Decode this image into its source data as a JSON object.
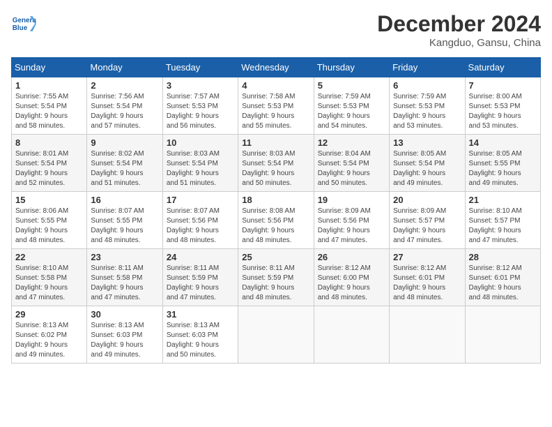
{
  "header": {
    "logo_line1": "General",
    "logo_line2": "Blue",
    "month": "December 2024",
    "location": "Kangduo, Gansu, China"
  },
  "weekdays": [
    "Sunday",
    "Monday",
    "Tuesday",
    "Wednesday",
    "Thursday",
    "Friday",
    "Saturday"
  ],
  "weeks": [
    [
      {
        "day": "1",
        "info": "Sunrise: 7:55 AM\nSunset: 5:54 PM\nDaylight: 9 hours\nand 58 minutes."
      },
      {
        "day": "2",
        "info": "Sunrise: 7:56 AM\nSunset: 5:54 PM\nDaylight: 9 hours\nand 57 minutes."
      },
      {
        "day": "3",
        "info": "Sunrise: 7:57 AM\nSunset: 5:53 PM\nDaylight: 9 hours\nand 56 minutes."
      },
      {
        "day": "4",
        "info": "Sunrise: 7:58 AM\nSunset: 5:53 PM\nDaylight: 9 hours\nand 55 minutes."
      },
      {
        "day": "5",
        "info": "Sunrise: 7:59 AM\nSunset: 5:53 PM\nDaylight: 9 hours\nand 54 minutes."
      },
      {
        "day": "6",
        "info": "Sunrise: 7:59 AM\nSunset: 5:53 PM\nDaylight: 9 hours\nand 53 minutes."
      },
      {
        "day": "7",
        "info": "Sunrise: 8:00 AM\nSunset: 5:53 PM\nDaylight: 9 hours\nand 53 minutes."
      }
    ],
    [
      {
        "day": "8",
        "info": "Sunrise: 8:01 AM\nSunset: 5:54 PM\nDaylight: 9 hours\nand 52 minutes."
      },
      {
        "day": "9",
        "info": "Sunrise: 8:02 AM\nSunset: 5:54 PM\nDaylight: 9 hours\nand 51 minutes."
      },
      {
        "day": "10",
        "info": "Sunrise: 8:03 AM\nSunset: 5:54 PM\nDaylight: 9 hours\nand 51 minutes."
      },
      {
        "day": "11",
        "info": "Sunrise: 8:03 AM\nSunset: 5:54 PM\nDaylight: 9 hours\nand 50 minutes."
      },
      {
        "day": "12",
        "info": "Sunrise: 8:04 AM\nSunset: 5:54 PM\nDaylight: 9 hours\nand 50 minutes."
      },
      {
        "day": "13",
        "info": "Sunrise: 8:05 AM\nSunset: 5:54 PM\nDaylight: 9 hours\nand 49 minutes."
      },
      {
        "day": "14",
        "info": "Sunrise: 8:05 AM\nSunset: 5:55 PM\nDaylight: 9 hours\nand 49 minutes."
      }
    ],
    [
      {
        "day": "15",
        "info": "Sunrise: 8:06 AM\nSunset: 5:55 PM\nDaylight: 9 hours\nand 48 minutes."
      },
      {
        "day": "16",
        "info": "Sunrise: 8:07 AM\nSunset: 5:55 PM\nDaylight: 9 hours\nand 48 minutes."
      },
      {
        "day": "17",
        "info": "Sunrise: 8:07 AM\nSunset: 5:56 PM\nDaylight: 9 hours\nand 48 minutes."
      },
      {
        "day": "18",
        "info": "Sunrise: 8:08 AM\nSunset: 5:56 PM\nDaylight: 9 hours\nand 48 minutes."
      },
      {
        "day": "19",
        "info": "Sunrise: 8:09 AM\nSunset: 5:56 PM\nDaylight: 9 hours\nand 47 minutes."
      },
      {
        "day": "20",
        "info": "Sunrise: 8:09 AM\nSunset: 5:57 PM\nDaylight: 9 hours\nand 47 minutes."
      },
      {
        "day": "21",
        "info": "Sunrise: 8:10 AM\nSunset: 5:57 PM\nDaylight: 9 hours\nand 47 minutes."
      }
    ],
    [
      {
        "day": "22",
        "info": "Sunrise: 8:10 AM\nSunset: 5:58 PM\nDaylight: 9 hours\nand 47 minutes."
      },
      {
        "day": "23",
        "info": "Sunrise: 8:11 AM\nSunset: 5:58 PM\nDaylight: 9 hours\nand 47 minutes."
      },
      {
        "day": "24",
        "info": "Sunrise: 8:11 AM\nSunset: 5:59 PM\nDaylight: 9 hours\nand 47 minutes."
      },
      {
        "day": "25",
        "info": "Sunrise: 8:11 AM\nSunset: 5:59 PM\nDaylight: 9 hours\nand 48 minutes."
      },
      {
        "day": "26",
        "info": "Sunrise: 8:12 AM\nSunset: 6:00 PM\nDaylight: 9 hours\nand 48 minutes."
      },
      {
        "day": "27",
        "info": "Sunrise: 8:12 AM\nSunset: 6:01 PM\nDaylight: 9 hours\nand 48 minutes."
      },
      {
        "day": "28",
        "info": "Sunrise: 8:12 AM\nSunset: 6:01 PM\nDaylight: 9 hours\nand 48 minutes."
      }
    ],
    [
      {
        "day": "29",
        "info": "Sunrise: 8:13 AM\nSunset: 6:02 PM\nDaylight: 9 hours\nand 49 minutes."
      },
      {
        "day": "30",
        "info": "Sunrise: 8:13 AM\nSunset: 6:03 PM\nDaylight: 9 hours\nand 49 minutes."
      },
      {
        "day": "31",
        "info": "Sunrise: 8:13 AM\nSunset: 6:03 PM\nDaylight: 9 hours\nand 50 minutes."
      },
      null,
      null,
      null,
      null
    ]
  ]
}
